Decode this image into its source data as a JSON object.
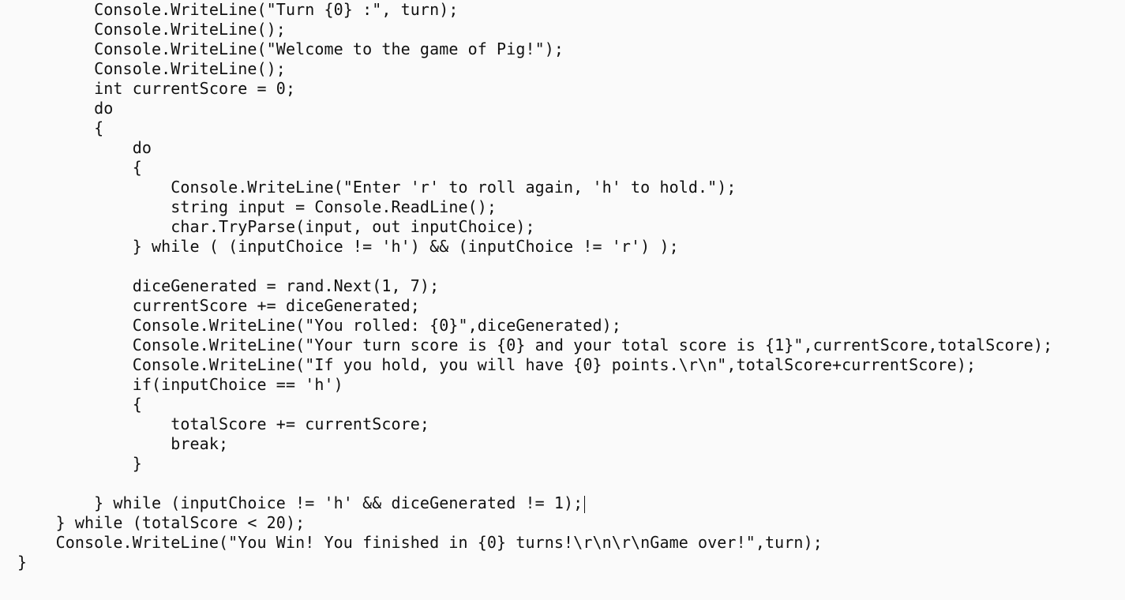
{
  "editor": {
    "lines": [
      "        Console.WriteLine(\"Turn {0} :\", turn);",
      "        Console.WriteLine();",
      "        Console.WriteLine(\"Welcome to the game of Pig!\");",
      "        Console.WriteLine();",
      "        int currentScore = 0;",
      "        do",
      "        {",
      "            do",
      "            {",
      "                Console.WriteLine(\"Enter 'r' to roll again, 'h' to hold.\");",
      "                string input = Console.ReadLine();",
      "                char.TryParse(input, out inputChoice);",
      "            } while ( (inputChoice != 'h') && (inputChoice != 'r') );",
      "",
      "            diceGenerated = rand.Next(1, 7);",
      "            currentScore += diceGenerated;",
      "            Console.WriteLine(\"You rolled: {0}\",diceGenerated);",
      "            Console.WriteLine(\"Your turn score is {0} and your total score is {1}\",currentScore,totalScore);",
      "            Console.WriteLine(\"If you hold, you will have {0} points.\\r\\n\",totalScore+currentScore);",
      "            if(inputChoice == 'h')",
      "            {",
      "                totalScore += currentScore;",
      "                break;",
      "            }",
      "",
      "        } while (inputChoice != 'h' && diceGenerated != 1);",
      "    } while (totalScore < 20);",
      "    Console.WriteLine(\"You Win! You finished in {0} turns!\\r\\n\\r\\nGame over!\",turn);",
      "}"
    ]
  }
}
